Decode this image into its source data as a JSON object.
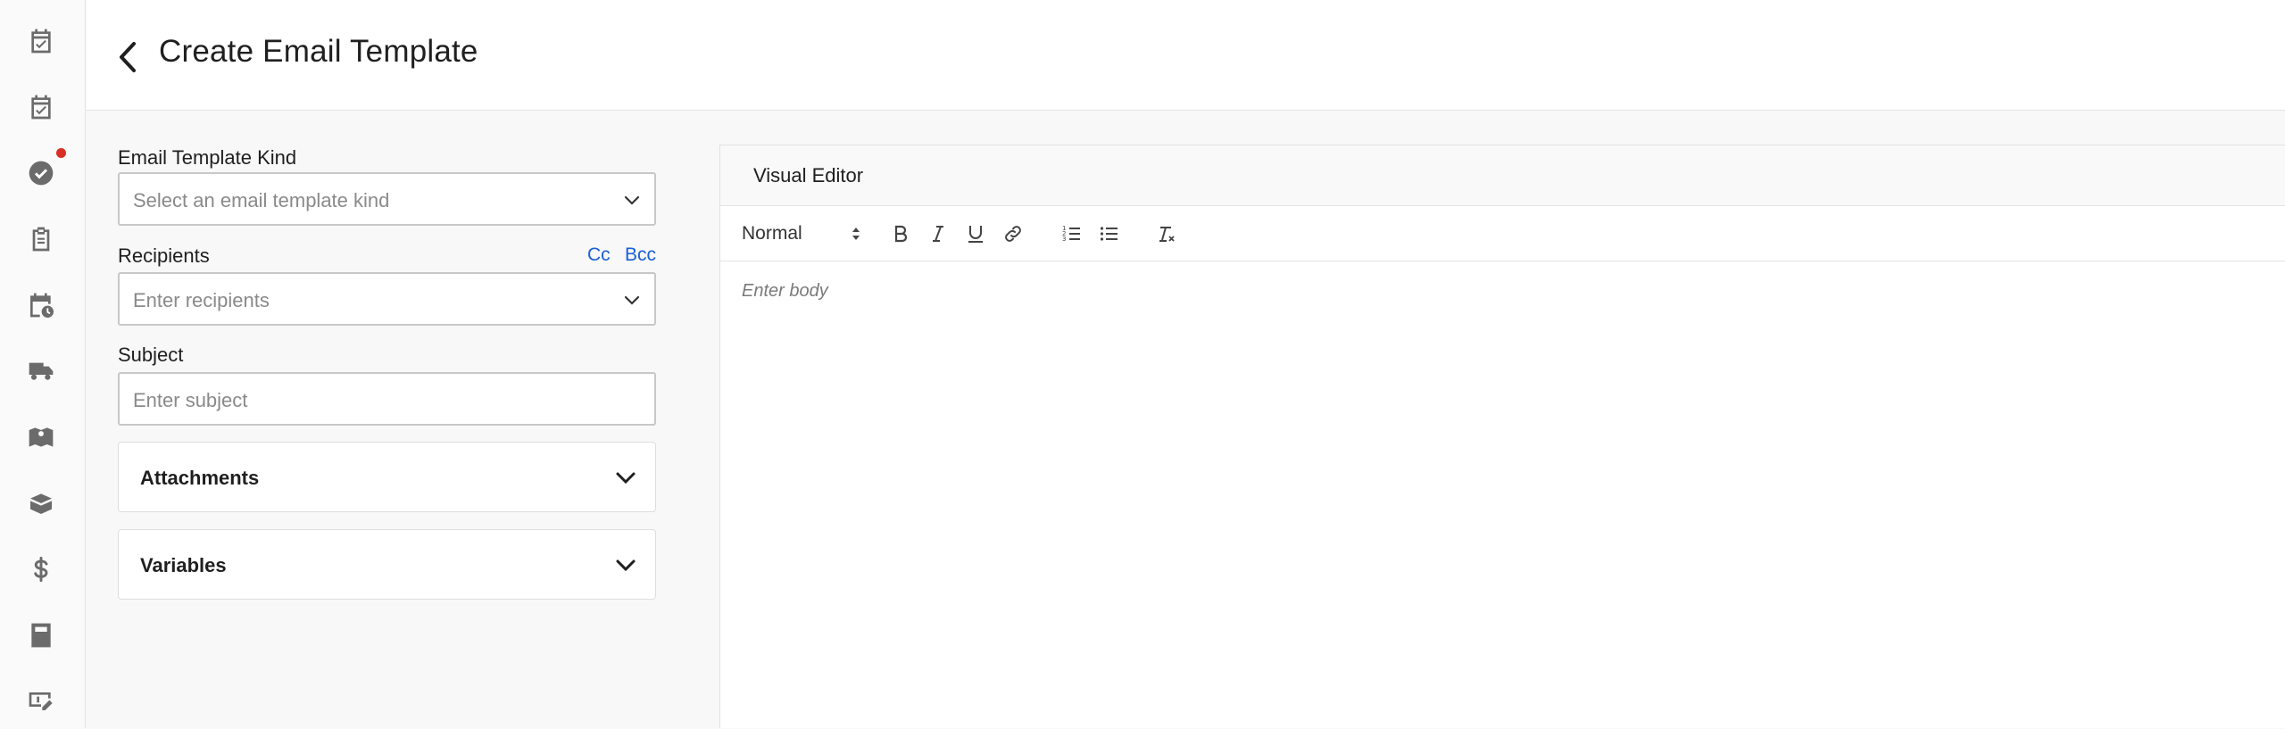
{
  "sidebar": {
    "items": [
      {
        "name": "calendar-check-icon"
      },
      {
        "name": "calendar-check-icon"
      },
      {
        "name": "check-circle-icon",
        "has_notification": true
      },
      {
        "name": "clipboard-icon"
      },
      {
        "name": "calendar-clock-icon"
      },
      {
        "name": "truck-icon"
      },
      {
        "name": "map-icon"
      },
      {
        "name": "box-icon"
      },
      {
        "name": "dollar-icon"
      },
      {
        "name": "calculator-icon"
      },
      {
        "name": "money-edit-icon"
      }
    ],
    "notification_color": "#d93025"
  },
  "header": {
    "title": "Create Email Template",
    "back_icon": "chevron-left-icon"
  },
  "form": {
    "kind": {
      "label": "Email Template Kind",
      "placeholder": "Select an email template kind"
    },
    "recipients": {
      "label": "Recipients",
      "placeholder": "Enter recipients",
      "cc_label": "Cc",
      "bcc_label": "Bcc"
    },
    "subject": {
      "label": "Subject",
      "placeholder": "Enter subject"
    },
    "attachments": {
      "title": "Attachments"
    },
    "variables": {
      "title": "Variables"
    }
  },
  "editor": {
    "title": "Visual Editor",
    "format_value": "Normal",
    "body_placeholder": "Enter body",
    "toolbar_icons": [
      "bold-icon",
      "italic-icon",
      "underline-icon",
      "link-icon",
      "ordered-list-icon",
      "bullet-list-icon",
      "clear-format-icon"
    ]
  },
  "colors": {
    "link": "#1a5ed8",
    "sidebar_icon": "#6b6b6b"
  }
}
